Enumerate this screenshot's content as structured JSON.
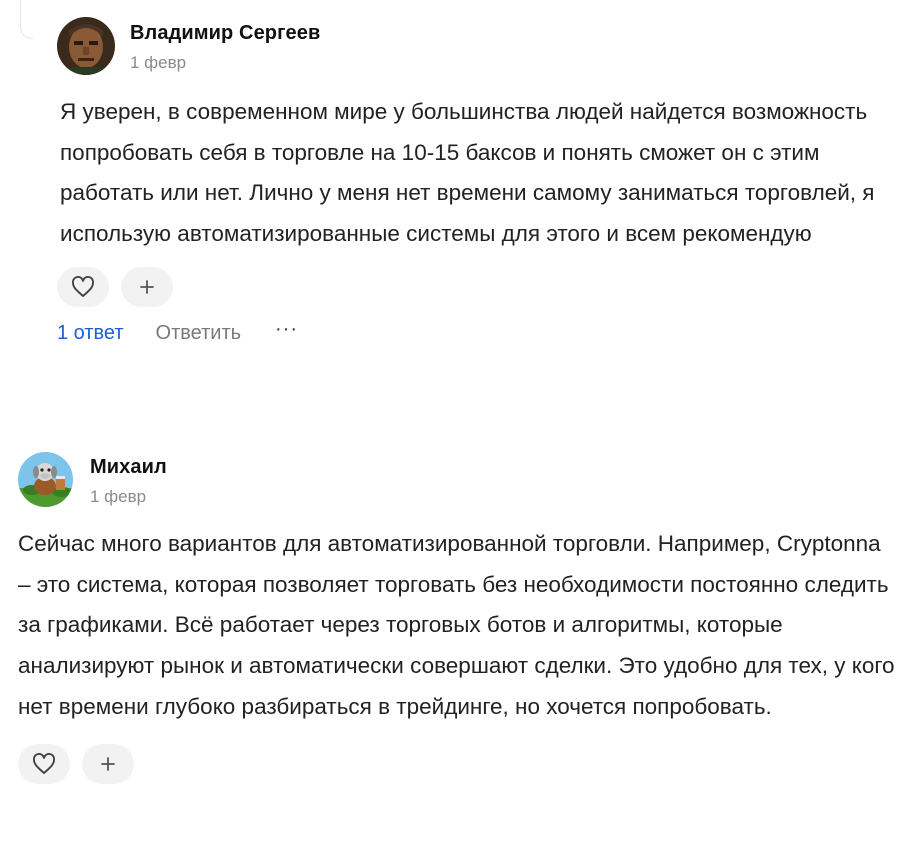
{
  "comments": [
    {
      "author": "Владимир Сергеев",
      "date": "1 февр",
      "text": "Я уверен, в современном мире у большинства людей найдется возможность попробовать себя в торговле на 10-15 баксов и понять сможет он с этим работать или нет. Лично у меня нет времени самому заниматься торговлей, я использую автоматизированные системы для этого и всем рекомендую",
      "replies_label": "1 ответ",
      "reply_label": "Ответить",
      "more_label": "···",
      "like_icon": "heart-icon",
      "add_reaction_icon": "plus-icon"
    },
    {
      "author": "Михаил",
      "date": "1 февр",
      "text": "Сейчас много вариантов для автоматизированной торговли. Например, Cryptonna – это система, которая позволяет торговать без необходимости постоянно следить за графиками. Всё работает через торговых ботов и алгоритмы, которые анализируют рынок и автоматически совершают сделки. Это удобно для тех, у кого нет времени глубоко разбираться в трейдинге, но хочется попробовать.",
      "like_icon": "heart-icon",
      "add_reaction_icon": "plus-icon"
    }
  ],
  "colors": {
    "link": "#1a5fd6",
    "muted": "#7a7a7a",
    "pill_bg": "#f2f2f2"
  }
}
